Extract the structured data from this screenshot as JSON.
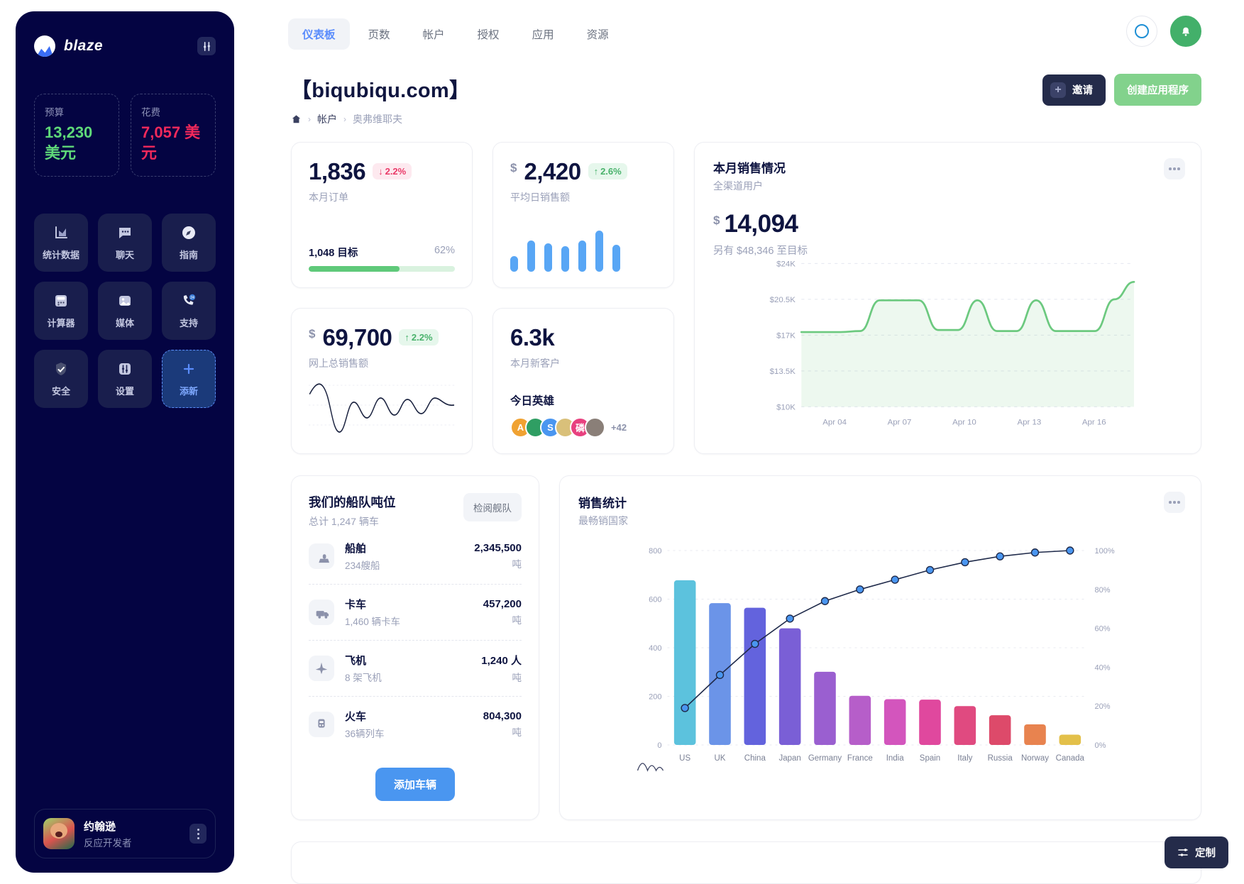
{
  "sidebar": {
    "brand": "blaze",
    "tool_icon": "sliders-icon",
    "stats": [
      {
        "label": "预算",
        "value": "13,230 美元",
        "color": "#5fd979"
      },
      {
        "label": "花费",
        "value": "7,057 美元",
        "color": "#f2295b"
      }
    ],
    "tiles": [
      {
        "label": "统计数据",
        "icon": "bar-chart-icon"
      },
      {
        "label": "聊天",
        "icon": "chat-bubble-icon"
      },
      {
        "label": "指南",
        "icon": "compass-icon"
      },
      {
        "label": "计算器",
        "icon": "calculator-icon"
      },
      {
        "label": "媒体",
        "icon": "image-icon"
      },
      {
        "label": "支持",
        "icon": "phone-24-icon"
      },
      {
        "label": "安全",
        "icon": "shield-icon"
      },
      {
        "label": "设置",
        "icon": "settings-icon"
      },
      {
        "label": "添新",
        "icon": "plus-icon"
      }
    ],
    "user": {
      "name": "约翰逊",
      "role": "反应开发者"
    }
  },
  "header": {
    "tabs": [
      {
        "label": "仪表板",
        "active": true
      },
      {
        "label": "页数",
        "active": false
      },
      {
        "label": "帐户",
        "active": false
      },
      {
        "label": "授权",
        "active": false
      },
      {
        "label": "应用",
        "active": false
      },
      {
        "label": "资源",
        "active": false
      }
    ],
    "title": "【biqubiqu.com】",
    "breadcrumb": [
      "帐户",
      "奥弗维耶夫"
    ],
    "invite_label": "邀请",
    "create_label": "创建应用程序"
  },
  "kpis": {
    "orders": {
      "value": "1,836",
      "delta": "2.2%",
      "delta_dir": "down",
      "label": "本月订单",
      "goal_label": "1,048 目标",
      "goal_pct": "62%",
      "goal_value": 62
    },
    "daily_sales": {
      "currency": "$",
      "value": "2,420",
      "delta": "2.6%",
      "delta_dir": "up",
      "label": "平均日销售额"
    },
    "total_sales": {
      "currency": "$",
      "value": "69,700",
      "delta": "2.2%",
      "delta_dir": "up",
      "label": "网上总销售额"
    },
    "new_customers": {
      "value": "6.3k",
      "label": "本月新客户",
      "heroes_title": "今日英雄",
      "heroes_more": "+42",
      "heroes": [
        {
          "initial": "A",
          "color": "#f0a232"
        },
        {
          "initial": "",
          "color": "#2f9e63"
        },
        {
          "initial": "S",
          "color": "#4a96f0"
        },
        {
          "initial": "",
          "color": "#d9c07a"
        },
        {
          "initial": "磷",
          "color": "#e8417f"
        },
        {
          "initial": "",
          "color": "#8a7f78"
        }
      ]
    }
  },
  "sales_panel": {
    "title": "本月销售情况",
    "subtitle": "全渠道用户",
    "currency": "$",
    "amount": "14,094",
    "goal_text": "另有 $48,346 至目标"
  },
  "fleet": {
    "title": "我们的船队吨位",
    "subtitle": "总计 1,247 辆车",
    "review_btn": "检阅舰队",
    "add_btn": "添加车辆",
    "items": [
      {
        "name": "船舶",
        "sub": "234艘船",
        "value": "2,345,500",
        "unit": "吨",
        "icon": "ship-icon"
      },
      {
        "name": "卡车",
        "sub": "1,460 辆卡车",
        "value": "457,200",
        "unit": "吨",
        "icon": "truck-icon"
      },
      {
        "name": "飞机",
        "sub": "8 架飞机",
        "value": "1,240 人",
        "unit": "吨",
        "icon": "plane-icon"
      },
      {
        "name": "火车",
        "sub": "36辆列车",
        "value": "804,300",
        "unit": "吨",
        "icon": "train-icon"
      }
    ]
  },
  "stats_panel": {
    "title": "销售统计",
    "subtitle": "最畅销国家"
  },
  "footer": {
    "customize": "定制"
  },
  "chart_data": [
    {
      "type": "area",
      "title": "本月销售情况",
      "xlabel": "",
      "ylabel": "",
      "x": [
        "Apr 04",
        "Apr 07",
        "Apr 10",
        "Apr 13",
        "Apr 16"
      ],
      "ytick_labels": [
        "$24K",
        "$20.5K",
        "$17K",
        "$13.5K",
        "$10K"
      ],
      "ylim": [
        10000,
        24000
      ],
      "grid": true,
      "values": [
        17300,
        17300,
        17300,
        17400,
        20400,
        20400,
        20400,
        17500,
        17500,
        20400,
        17400,
        17400,
        20400,
        17400,
        17400,
        17400,
        20500,
        22200
      ],
      "line_color": "#6cc97f"
    },
    {
      "type": "bar",
      "title": "销售统计",
      "subtitle": "最畅销国家",
      "categories": [
        "US",
        "UK",
        "China",
        "Japan",
        "Germany",
        "France",
        "India",
        "Spain",
        "Italy",
        "Russia",
        "Norway",
        "Canada"
      ],
      "values": [
        720,
        620,
        600,
        510,
        320,
        215,
        200,
        198,
        170,
        130,
        90,
        45
      ],
      "ylabel": "",
      "ytick_labels": [
        "0",
        "200",
        "400",
        "600",
        "800"
      ],
      "ylim": [
        0,
        850
      ],
      "secondary_axis": {
        "name": "cumulative",
        "tick_labels": [
          "0%",
          "20%",
          "40%",
          "60%",
          "80%",
          "100%"
        ],
        "values": [
          19,
          36,
          52,
          65,
          74,
          80,
          85,
          90,
          94,
          97,
          99,
          100
        ],
        "line_color": "#1f2a4a",
        "marker_color": "#4a96f0"
      },
      "bar_colors": [
        "#5cc2dd",
        "#6b94e8",
        "#6363dd",
        "#7a5fd6",
        "#9a5fd0",
        "#b65ec9",
        "#d355bd",
        "#e0489e",
        "#e04a80",
        "#dd4a6a",
        "#e8834f",
        "#e3c04a"
      ],
      "grid": true
    }
  ]
}
